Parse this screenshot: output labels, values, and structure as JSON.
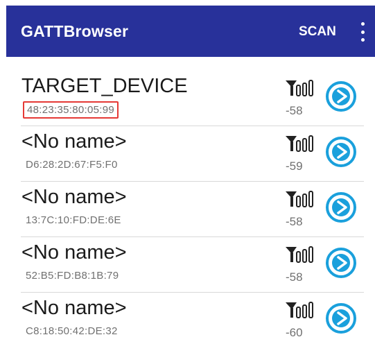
{
  "app": {
    "title": "GATTBrowser",
    "scan_label": "SCAN"
  },
  "colors": {
    "appbar": "#28319a",
    "connect_icon": "#1aa0dc",
    "highlight_border": "#e53935"
  },
  "devices": [
    {
      "name": "TARGET_DEVICE",
      "address": "48:23:35:80:05:99",
      "rssi": "-58",
      "highlighted": true
    },
    {
      "name": "<No name>",
      "address": "D6:28:2D:67:F5:F0",
      "rssi": "-59",
      "highlighted": false
    },
    {
      "name": "<No name>",
      "address": "13:7C:10:FD:DE:6E",
      "rssi": "-58",
      "highlighted": false
    },
    {
      "name": "<No name>",
      "address": "52:B5:FD:B8:1B:79",
      "rssi": "-58",
      "highlighted": false
    },
    {
      "name": "<No name>",
      "address": "C8:18:50:42:DE:32",
      "rssi": "-60",
      "highlighted": false
    }
  ],
  "icons": {
    "signal": "signal-strength-icon",
    "connect": "play-circle-icon",
    "menu": "more-vert-icon"
  }
}
